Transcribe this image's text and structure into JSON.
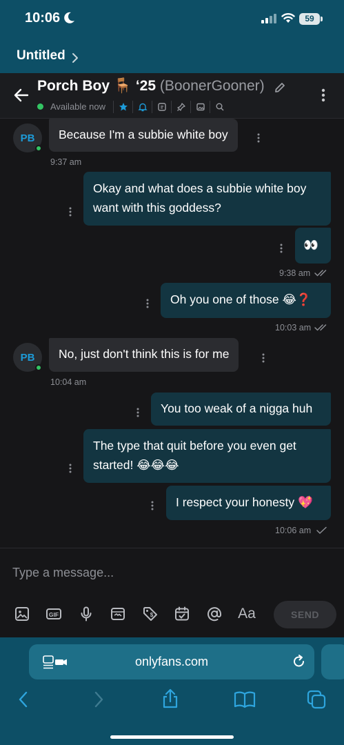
{
  "status_bar": {
    "time": "10:06",
    "battery": "59"
  },
  "notes_bar": {
    "title": "Untitled"
  },
  "chat_header": {
    "name": "Porch Boy 🪑 ‘25",
    "handle": "(BoonerGooner)",
    "status": "Available now"
  },
  "contact": {
    "initials": "PB"
  },
  "messages": [
    {
      "dir": "in",
      "text": "Because I'm a subbie white boy",
      "time": "9:37 am"
    },
    {
      "dir": "out",
      "lines": [
        "Okay and what does a subbie white boy",
        "want with this goddess?"
      ]
    },
    {
      "dir": "out",
      "text": "👀",
      "time": "9:38 am"
    },
    {
      "dir": "out",
      "text": "Oh you one of those 😂❓",
      "time": "10:03 am"
    },
    {
      "dir": "in",
      "text": "No, just don't think this is for me",
      "time": "10:04 am"
    },
    {
      "dir": "out",
      "text": "You too weak of a nigga huh"
    },
    {
      "dir": "out",
      "lines": [
        "The type that quit before you even get",
        "started! 😂😂😂"
      ]
    },
    {
      "dir": "out",
      "text": "I respect your honesty 💖",
      "time": "10:06 am"
    }
  ],
  "composer": {
    "placeholder": "Type a message...",
    "send_label": "SEND",
    "tools": [
      "image-icon",
      "gif-icon",
      "microphone-icon",
      "vault-icon",
      "price-tag-icon",
      "schedule-icon",
      "mention-icon",
      "text-format-icon"
    ],
    "format_label": "Aa",
    "gif_label": "GIF"
  },
  "browser": {
    "url": "onlyfans.com"
  },
  "colors": {
    "accent": "#1d9bd8",
    "online": "#33c463",
    "outgoing_bubble": "#133541",
    "incoming_bubble": "#2b2c30",
    "safari_bar": "#0d4f66"
  }
}
